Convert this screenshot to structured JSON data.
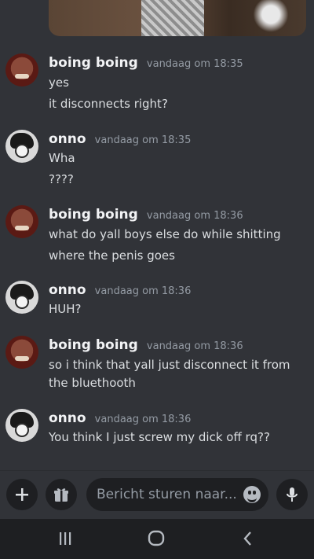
{
  "messages": [
    {
      "username": "boing boing",
      "timestamp": "vandaag om 18:35",
      "lines": [
        "yes",
        "it disconnects right?"
      ]
    },
    {
      "username": "onno",
      "timestamp": "vandaag om 18:35",
      "lines": [
        "Wha",
        "????"
      ]
    },
    {
      "username": "boing boing",
      "timestamp": "vandaag om 18:36",
      "lines": [
        "what do yall boys else do while shitting",
        "where the penis goes"
      ]
    },
    {
      "username": "onno",
      "timestamp": "vandaag om 18:36",
      "lines": [
        "HUH?"
      ]
    },
    {
      "username": "boing boing",
      "timestamp": "vandaag om 18:36",
      "lines": [
        "so i think that yall just disconnect it from the bluethooth"
      ]
    },
    {
      "username": "onno",
      "timestamp": "vandaag om 18:36",
      "lines": [
        "You think I just screw my dick off rq??"
      ]
    }
  ],
  "composer": {
    "placeholder": "Bericht sturen naar..."
  },
  "icons": {
    "add": "plus-icon",
    "gift": "gift-icon",
    "emoji": "emoji-icon",
    "mic": "microphone-icon",
    "nav_recent": "recent-apps-icon",
    "nav_home": "home-icon",
    "nav_back": "back-icon"
  },
  "colors": {
    "background": "#313338",
    "input_bg": "#1e1f22",
    "username": "#f2f3f5",
    "timestamp": "#949ba4"
  }
}
